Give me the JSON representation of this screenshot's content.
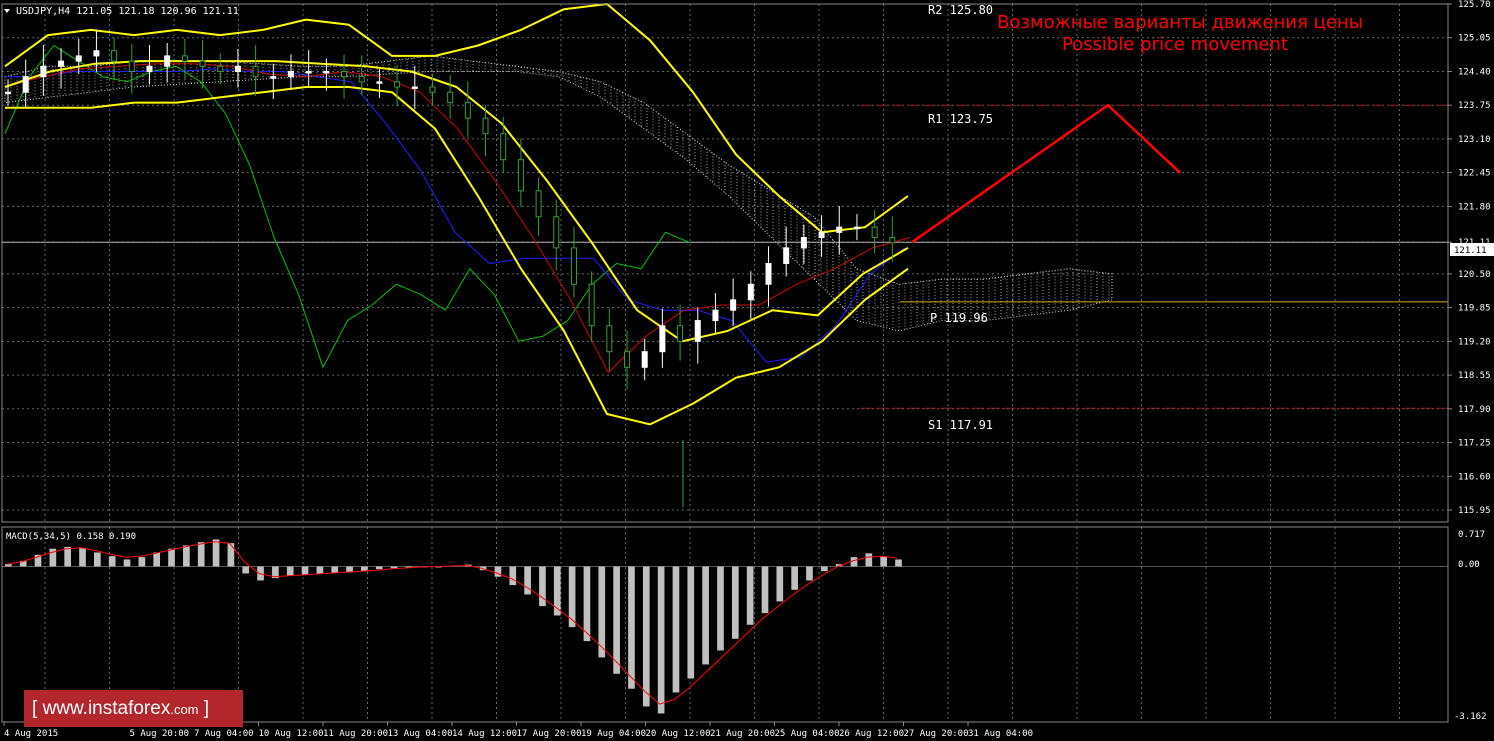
{
  "header": {
    "symbol_info": "USDJPY,H4  121.05 121.18 120.96 121.11"
  },
  "annotation": {
    "line1": "Возможные варианты движения цены",
    "line2": "Possible price movement"
  },
  "levels": [
    {
      "label": "R2 125.80",
      "price": 125.8
    },
    {
      "label": "R1 123.75",
      "price": 123.75
    },
    {
      "label": "P 119.96",
      "price": 119.96
    },
    {
      "label": "S1 117.91",
      "price": 117.91
    }
  ],
  "current_price_label": "121.11",
  "macd": {
    "label": "MACD(5,34,5) 0.158 0.190",
    "ticks": [
      "0.717",
      "0.00",
      "-3.162"
    ]
  },
  "watermark": {
    "bracket_open": "[",
    "site": "www.instaforex",
    "domain": ".com",
    "bracket_close": "]"
  },
  "colors": {
    "background": "#000000",
    "grid": "#5c6c6c",
    "bollinger": "#ffff00",
    "annotation": "#ff0000",
    "level_line": "#8b1a1a",
    "macd_bar": "#c0c0c0",
    "macd_signal": "#ff0000",
    "chikou": "#00c000",
    "kijun": "#2020ff",
    "tenkan": "#cc0000"
  },
  "chart_data": [
    {
      "type": "candlestick",
      "title": "USDJPY,H4",
      "ylim": [
        115.95,
        125.7
      ],
      "y_ticks": [
        "125.70",
        "125.05",
        "124.40",
        "123.75",
        "123.10",
        "122.45",
        "121.80",
        "121.11",
        "120.50",
        "119.85",
        "119.20",
        "118.55",
        "117.90",
        "117.25",
        "116.60",
        "115.95"
      ],
      "x_ticks": [
        "4 Aug 2015",
        "5 Aug 20:00",
        "7 Aug 04:00",
        "10 Aug 12:00",
        "11 Aug 20:00",
        "13 Aug 04:00",
        "14 Aug 12:00",
        "17 Aug 20:00",
        "19 Aug 04:00",
        "20 Aug 12:00",
        "21 Aug 20:00",
        "25 Aug 04:00",
        "26 Aug 12:00",
        "27 Aug 20:00",
        "31 Aug 04:00"
      ],
      "grid": true,
      "close_approx": [
        124.0,
        124.3,
        124.5,
        124.6,
        124.7,
        124.8,
        124.6,
        124.4,
        124.5,
        124.7,
        124.6,
        124.5,
        124.4,
        124.5,
        124.3,
        124.3,
        124.4,
        124.4,
        124.4,
        124.3,
        124.2,
        124.2,
        124.1,
        124.1,
        124.0,
        123.8,
        123.5,
        123.2,
        122.7,
        122.1,
        121.6,
        121.0,
        120.3,
        119.5,
        119.0,
        118.7,
        119.0,
        119.5,
        119.2,
        119.6,
        119.8,
        120.0,
        120.3,
        120.7,
        121.0,
        121.2,
        121.3,
        121.4,
        121.4,
        121.2,
        121.1
      ],
      "bollinger_upper": [
        124.5,
        125.1,
        125.2,
        125.1,
        125.2,
        125.1,
        125.2,
        125.4,
        125.3,
        124.7,
        124.7,
        124.9,
        125.2,
        125.6,
        125.7,
        125.0,
        124.0,
        122.8,
        122.0,
        121.3,
        121.4,
        122.0
      ],
      "bollinger_lower": [
        123.7,
        123.7,
        123.7,
        123.8,
        123.8,
        123.9,
        124.0,
        124.1,
        124.1,
        124.0,
        123.3,
        122.0,
        120.6,
        119.4,
        117.8,
        117.6,
        118.0,
        118.5,
        118.7,
        119.2,
        120.0,
        120.6
      ],
      "annotation_path": [
        121.11,
        123.75,
        122.45
      ],
      "levels": [
        125.8,
        123.75,
        119.96,
        117.91
      ],
      "current_price": 121.11
    },
    {
      "type": "bar",
      "title": "MACD(5,34,5) 0.158 0.190",
      "ylim": [
        -3.162,
        0.717
      ],
      "values": [
        0.05,
        0.12,
        0.25,
        0.38,
        0.42,
        0.4,
        0.3,
        0.22,
        0.15,
        0.2,
        0.3,
        0.38,
        0.45,
        0.52,
        0.58,
        0.5,
        -0.15,
        -0.3,
        -0.25,
        -0.2,
        -0.18,
        -0.16,
        -0.14,
        -0.12,
        -0.1,
        -0.06,
        -0.04,
        -0.02,
        -0.01,
        0.0,
        0.02,
        0.04,
        -0.08,
        -0.22,
        -0.4,
        -0.6,
        -0.85,
        -1.05,
        -1.3,
        -1.6,
        -1.95,
        -2.3,
        -2.62,
        -3.0,
        -3.15,
        -2.7,
        -2.4,
        -2.1,
        -1.8,
        -1.55,
        -1.25,
        -1.0,
        -0.75,
        -0.5,
        -0.3,
        -0.1,
        0.05,
        0.2,
        0.28,
        0.22,
        0.15
      ],
      "signal": [
        0.05,
        0.1,
        0.2,
        0.3,
        0.38,
        0.4,
        0.34,
        0.26,
        0.2,
        0.22,
        0.28,
        0.35,
        0.42,
        0.48,
        0.53,
        0.5,
        0.1,
        -0.15,
        -0.22,
        -0.2,
        -0.18,
        -0.16,
        -0.14,
        -0.12,
        -0.1,
        -0.08,
        -0.05,
        -0.03,
        -0.01,
        0.0,
        0.01,
        0.02,
        -0.04,
        -0.14,
        -0.26,
        -0.44,
        -0.65,
        -0.88,
        -1.12,
        -1.4,
        -1.7,
        -2.02,
        -2.35,
        -2.68,
        -2.95,
        -2.85,
        -2.6,
        -2.3,
        -2.0,
        -1.7,
        -1.4,
        -1.1,
        -0.85,
        -0.6,
        -0.38,
        -0.18,
        0.0,
        0.12,
        0.2,
        0.22,
        0.18
      ]
    }
  ]
}
